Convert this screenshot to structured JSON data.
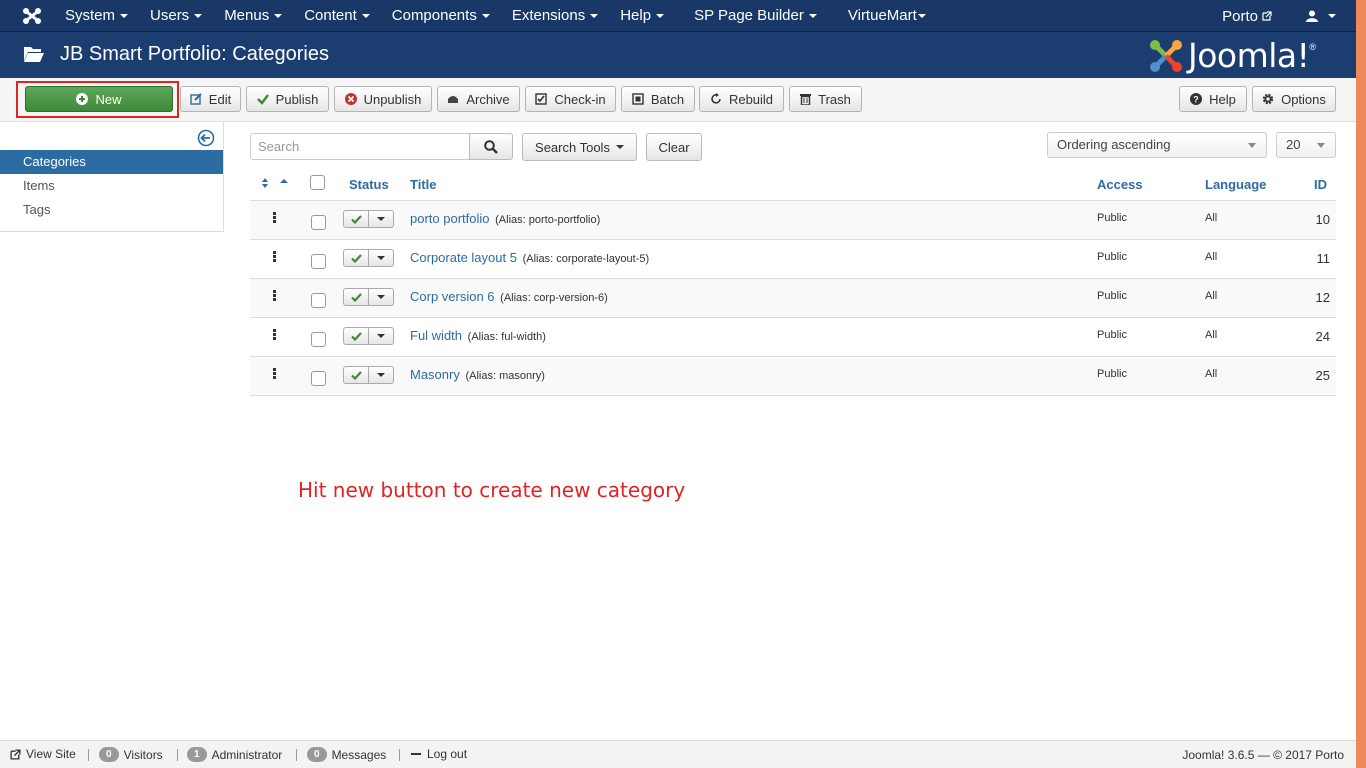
{
  "topnav": {
    "menu": [
      {
        "label": "System"
      },
      {
        "label": "Users"
      },
      {
        "label": "Menus"
      },
      {
        "label": "Content"
      },
      {
        "label": "Components"
      },
      {
        "label": "Extensions"
      },
      {
        "label": "Help"
      },
      {
        "label": "SP Page Builder"
      },
      {
        "label": "VirtueMart"
      }
    ],
    "site_link": "Porto"
  },
  "header": {
    "title": "JB Smart Portfolio: Categories",
    "logo_text": "Joomla!",
    "logo_reg": "®"
  },
  "toolbar": {
    "new": "New",
    "edit": "Edit",
    "publish": "Publish",
    "unpublish": "Unpublish",
    "archive": "Archive",
    "checkin": "Check-in",
    "batch": "Batch",
    "rebuild": "Rebuild",
    "trash": "Trash",
    "help": "Help",
    "options": "Options"
  },
  "sidebar": {
    "items": [
      {
        "label": "Categories",
        "active": true
      },
      {
        "label": "Items",
        "active": false
      },
      {
        "label": "Tags",
        "active": false
      }
    ]
  },
  "filters": {
    "search_placeholder": "Search",
    "search_tools": "Search Tools",
    "clear": "Clear",
    "ordering": "Ordering ascending",
    "limit": "20"
  },
  "table": {
    "headers": {
      "status": "Status",
      "title": "Title",
      "access": "Access",
      "language": "Language",
      "id": "ID"
    },
    "rows": [
      {
        "title": "porto portfolio",
        "alias": "(Alias: porto-portfolio)",
        "access": "Public",
        "language": "All",
        "id": "10"
      },
      {
        "title": "Corporate layout 5",
        "alias": "(Alias: corporate-layout-5)",
        "access": "Public",
        "language": "All",
        "id": "11"
      },
      {
        "title": "Corp version 6",
        "alias": "(Alias: corp-version-6)",
        "access": "Public",
        "language": "All",
        "id": "12"
      },
      {
        "title": "Ful width",
        "alias": "(Alias: ful-width)",
        "access": "Public",
        "language": "All",
        "id": "24"
      },
      {
        "title": "Masonry",
        "alias": "(Alias: masonry)",
        "access": "Public",
        "language": "All",
        "id": "25"
      }
    ]
  },
  "annotation": "Hit new button to create new category",
  "statusbar": {
    "view_site": "View Site",
    "visitors_count": "0",
    "visitors": "Visitors",
    "admin_count": "1",
    "administrator": "Administrator",
    "messages_count": "0",
    "messages": "Messages",
    "logout": "Log out",
    "version": "Joomla! 3.6.5",
    "copyright": "— © 2017 Porto"
  },
  "colors": {
    "nav_bg": "#1a3867",
    "header_bg": "#1c3d6f",
    "accent_link": "#2d6ca2",
    "new_button": "#46924a",
    "highlight_red": "#e02424",
    "edge_strip": "#ee8a5a"
  }
}
